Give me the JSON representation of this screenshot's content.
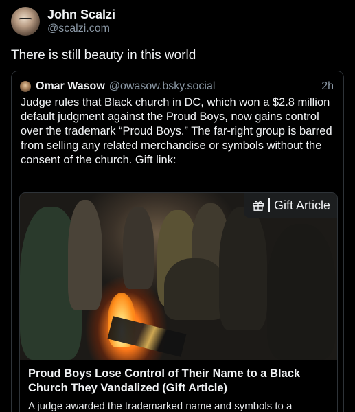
{
  "author": {
    "display_name": "John Scalzi",
    "handle": "@scalzi.com",
    "avatar_icon": "avatar-photo"
  },
  "post": {
    "text": "There is still beauty in this world"
  },
  "quote": {
    "display_name": "Omar Wasow",
    "handle": "@owasow.bsky.social",
    "time": "2h",
    "text": "Judge rules that Black church in DC, which won a $2.8 million default judgment against the Proud Boys, now gains control over the trademark “Proud Boys.” The far-right group is barred from selling any related merchandise or symbols without the consent of the church. Gift link:"
  },
  "card": {
    "badge_label": "Gift Article",
    "badge_icon": "gift-icon",
    "title": "Proud Boys Lose Control of Their Name to a Black Church They Vandalized (Gift Article)",
    "description": "A judge awarded the trademarked name and symbols to a"
  },
  "colors": {
    "background": "#000000",
    "text_primary": "#f1f3f5",
    "text_secondary": "#8b98a5",
    "border": "#2e3338"
  }
}
